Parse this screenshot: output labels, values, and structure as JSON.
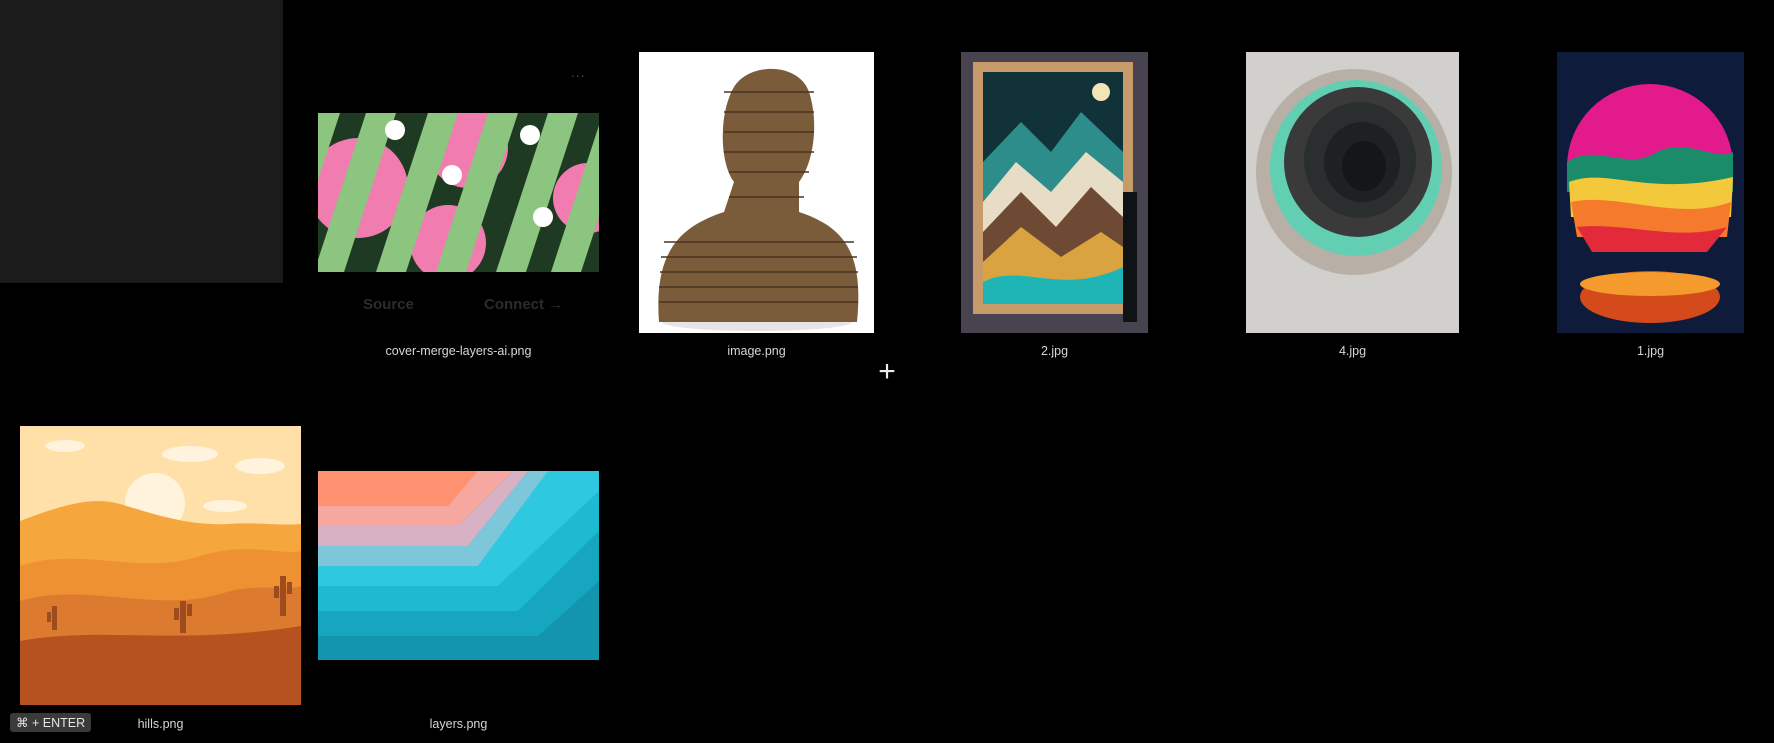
{
  "add_tile": {
    "plus": "+",
    "shortcut": "⌘ + ENTER"
  },
  "cover_card": {
    "menu": "...",
    "source_label": "Source",
    "connect_label": "Connect →"
  },
  "items": [
    {
      "name": "cover-merge-layers-ai.png"
    },
    {
      "name": "image.png"
    },
    {
      "name": "2.jpg"
    },
    {
      "name": "4.jpg"
    },
    {
      "name": "1.jpg"
    },
    {
      "name": "hills.png"
    },
    {
      "name": "layers.png"
    }
  ],
  "colors": {
    "background": "#000000",
    "tile": "#1b1b1b",
    "caption": "#d6d6d6"
  }
}
